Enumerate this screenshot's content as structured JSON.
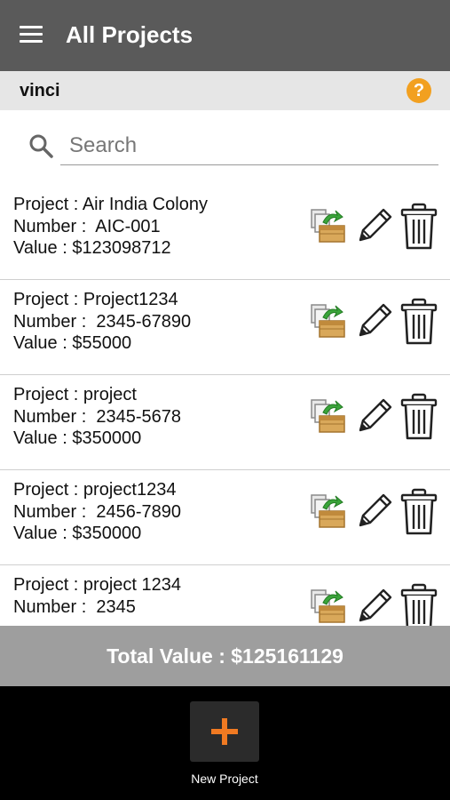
{
  "header": {
    "title": "All Projects",
    "menu_icon": "hamburger-menu-icon",
    "background": "#5a5a5a"
  },
  "user_bar": {
    "username": "vinci",
    "help_icon": "help-icon",
    "help_glyph": "?",
    "help_color": "#f2a020"
  },
  "search": {
    "placeholder": "Search",
    "value": "",
    "icon": "search-icon"
  },
  "projects": [
    {
      "project_line": "Project : Air India Colony",
      "number_line": "Number :  AIC-001",
      "value_line": "Value : $123098712"
    },
    {
      "project_line": "Project : Project1234",
      "number_line": "Number :  2345-67890",
      "value_line": "Value : $55000"
    },
    {
      "project_line": "Project : project",
      "number_line": "Number :  2345-5678",
      "value_line": "Value : $350000"
    },
    {
      "project_line": "Project : project1234",
      "number_line": "Number :  2456-7890",
      "value_line": "Value : $350000"
    },
    {
      "project_line": "Project : project 1234",
      "number_line": "Number :  2345",
      "value_line": ""
    }
  ],
  "row_actions": [
    "export-icon",
    "edit-pencil-icon",
    "delete-trash-icon"
  ],
  "total": {
    "text": "Total Value : $125161129"
  },
  "footer": {
    "new_project_label": "New Project",
    "plus_icon": "plus-icon",
    "accent": "#f07a22"
  }
}
